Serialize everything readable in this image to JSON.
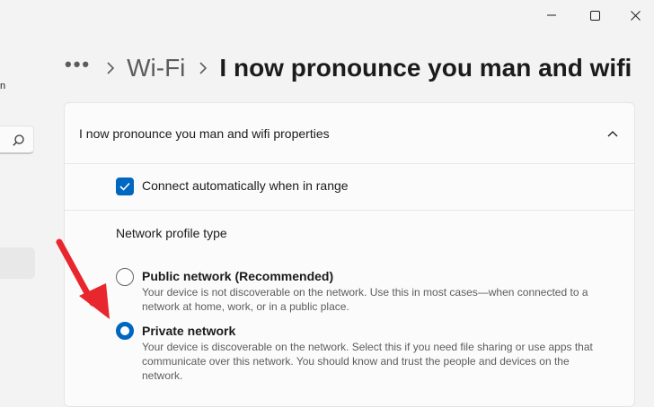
{
  "window": {
    "minimize_icon": "minimize-icon",
    "maximize_icon": "maximize-icon",
    "close_icon": "close-icon"
  },
  "sidebar": {
    "fragment_text": "n",
    "search_icon": "search-icon"
  },
  "breadcrumb": {
    "more": "•••",
    "parent": "Wi-Fi",
    "current": "I now pronounce you man and wifi"
  },
  "card": {
    "title": "I now pronounce you man and wifi properties",
    "auto_connect": {
      "label": "Connect automatically when in range",
      "checked": true
    },
    "profile_section_label": "Network profile type",
    "options": [
      {
        "title": "Public network (Recommended)",
        "description": "Your device is not discoverable on the network. Use this in most cases—when connected to a network at home, work, or in a public place.",
        "selected": false
      },
      {
        "title": "Private network",
        "description": "Your device is discoverable on the network. Select this if you need file sharing or use apps that communicate over this network. You should know and trust the people and devices on the network.",
        "selected": true
      }
    ]
  },
  "colors": {
    "accent": "#0067c0",
    "annotation_arrow": "#e8262d",
    "background": "#f3f3f3",
    "card": "#fbfbfb"
  }
}
